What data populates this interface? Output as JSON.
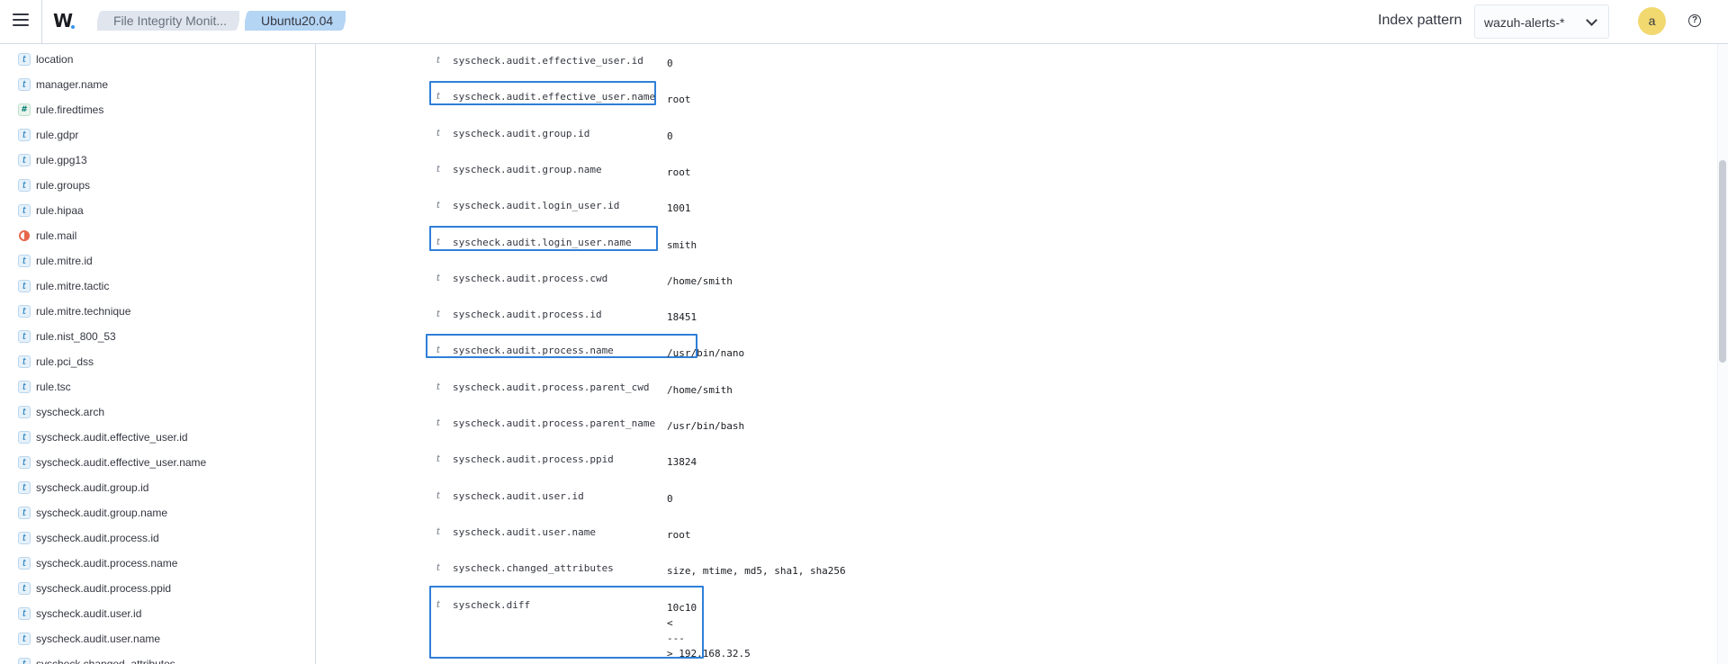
{
  "header": {
    "breadcrumb_1": "File Integrity Monit...",
    "breadcrumb_2": "Ubuntu20.04",
    "index_pattern_label": "Index pattern",
    "index_pattern_value": "wazuh-alerts-*",
    "avatar_initial": "a",
    "help_glyph": "?"
  },
  "sidebar": {
    "fields": [
      {
        "type": "t",
        "label": "location"
      },
      {
        "type": "t",
        "label": "manager.name"
      },
      {
        "type": "#",
        "label": "rule.firedtimes"
      },
      {
        "type": "t",
        "label": "rule.gdpr"
      },
      {
        "type": "t",
        "label": "rule.gpg13"
      },
      {
        "type": "t",
        "label": "rule.groups"
      },
      {
        "type": "t",
        "label": "rule.hipaa"
      },
      {
        "type": "geo",
        "label": "rule.mail"
      },
      {
        "type": "t",
        "label": "rule.mitre.id"
      },
      {
        "type": "t",
        "label": "rule.mitre.tactic"
      },
      {
        "type": "t",
        "label": "rule.mitre.technique"
      },
      {
        "type": "t",
        "label": "rule.nist_800_53"
      },
      {
        "type": "t",
        "label": "rule.pci_dss"
      },
      {
        "type": "t",
        "label": "rule.tsc"
      },
      {
        "type": "t",
        "label": "syscheck.arch"
      },
      {
        "type": "t",
        "label": "syscheck.audit.effective_user.id"
      },
      {
        "type": "t",
        "label": "syscheck.audit.effective_user.name"
      },
      {
        "type": "t",
        "label": "syscheck.audit.group.id"
      },
      {
        "type": "t",
        "label": "syscheck.audit.group.name"
      },
      {
        "type": "t",
        "label": "syscheck.audit.process.id"
      },
      {
        "type": "t",
        "label": "syscheck.audit.process.name"
      },
      {
        "type": "t",
        "label": "syscheck.audit.process.ppid"
      },
      {
        "type": "t",
        "label": "syscheck.audit.user.id"
      },
      {
        "type": "t",
        "label": "syscheck.audit.user.name"
      },
      {
        "type": "t",
        "label": "syscheck.changed_attributes"
      }
    ]
  },
  "document": {
    "rows": [
      {
        "type": "t",
        "key": "syscheck.audit.effective_user.id",
        "value": "0"
      },
      {
        "type": "t",
        "key": "syscheck.audit.effective_user.name",
        "value": "root"
      },
      {
        "type": "t",
        "key": "syscheck.audit.group.id",
        "value": "0"
      },
      {
        "type": "t",
        "key": "syscheck.audit.group.name",
        "value": "root"
      },
      {
        "type": "t",
        "key": "syscheck.audit.login_user.id",
        "value": "1001"
      },
      {
        "type": "t",
        "key": "syscheck.audit.login_user.name",
        "value": "smith"
      },
      {
        "type": "t",
        "key": "syscheck.audit.process.cwd",
        "value": "/home/smith"
      },
      {
        "type": "t",
        "key": "syscheck.audit.process.id",
        "value": "18451"
      },
      {
        "type": "t",
        "key": "syscheck.audit.process.name",
        "value": "/usr/bin/nano"
      },
      {
        "type": "t",
        "key": "syscheck.audit.process.parent_cwd",
        "value": "/home/smith"
      },
      {
        "type": "t",
        "key": "syscheck.audit.process.parent_name",
        "value": "/usr/bin/bash"
      },
      {
        "type": "t",
        "key": "syscheck.audit.process.ppid",
        "value": "13824"
      },
      {
        "type": "t",
        "key": "syscheck.audit.user.id",
        "value": "0"
      },
      {
        "type": "t",
        "key": "syscheck.audit.user.name",
        "value": "root"
      },
      {
        "type": "t",
        "key": "syscheck.changed_attributes",
        "value": "size, mtime, md5, sha1, sha256"
      },
      {
        "type": "t",
        "key": "syscheck.diff",
        "value_lines": [
          "10c10",
          "<",
          "---",
          "> 192.168.32.5"
        ]
      }
    ]
  }
}
